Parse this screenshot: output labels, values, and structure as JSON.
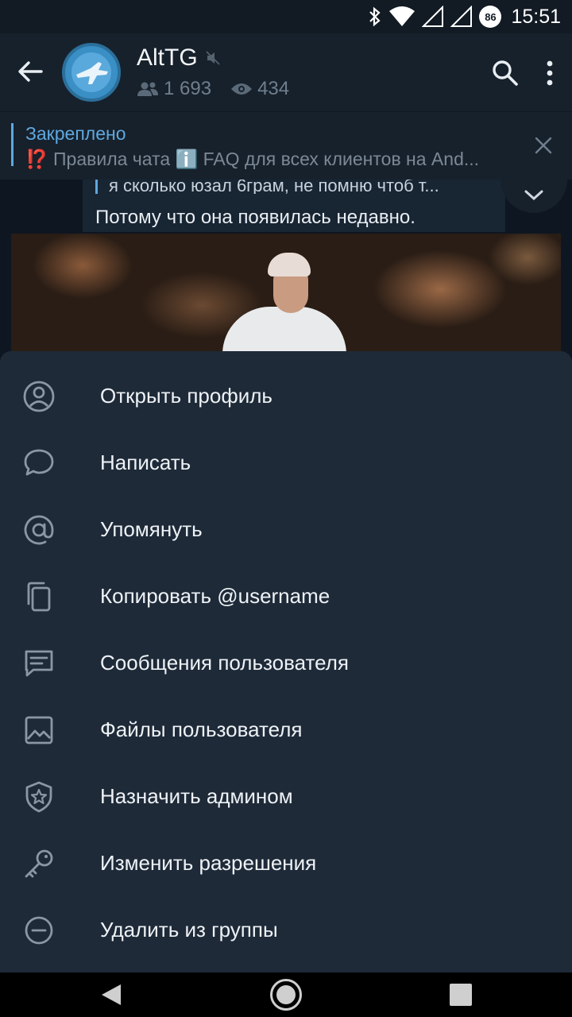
{
  "status_bar": {
    "time": "15:51",
    "battery": "86",
    "icons": [
      "bluetooth-icon",
      "wifi-icon",
      "signal-icon",
      "signal-icon",
      "battery-icon"
    ]
  },
  "header": {
    "title": "AltTG",
    "members": "1 693",
    "online": "434",
    "icons": [
      "back-arrow-icon",
      "mute-icon",
      "members-icon",
      "eye-icon",
      "search-icon",
      "more-icon"
    ]
  },
  "pinned": {
    "label": "Закреплено",
    "text": "⁉️ Правила чата  ℹ️ FAQ для всех клиентов на And..."
  },
  "chat": {
    "reply_text": "я сколько юзал 6грам, не помню чтоб т...",
    "message_text": "Потому что она появилась недавно."
  },
  "menu": {
    "items": [
      {
        "label": "Открыть профиль",
        "icon": "profile-icon"
      },
      {
        "label": "Написать",
        "icon": "chat-bubble-icon"
      },
      {
        "label": "Упомянуть",
        "icon": "at-sign-icon"
      },
      {
        "label": "Копировать @username",
        "icon": "copy-icon"
      },
      {
        "label": "Сообщения пользователя",
        "icon": "messages-icon"
      },
      {
        "label": "Файлы пользователя",
        "icon": "image-icon"
      },
      {
        "label": "Назначить админом",
        "icon": "shield-star-icon"
      },
      {
        "label": "Изменить разрешения",
        "icon": "key-icon"
      },
      {
        "label": "Удалить из группы",
        "icon": "remove-circle-icon"
      }
    ]
  },
  "colors": {
    "accent": "#5fa8e0",
    "sheet_bg": "#1e2a38",
    "header_bg": "#17212b"
  }
}
